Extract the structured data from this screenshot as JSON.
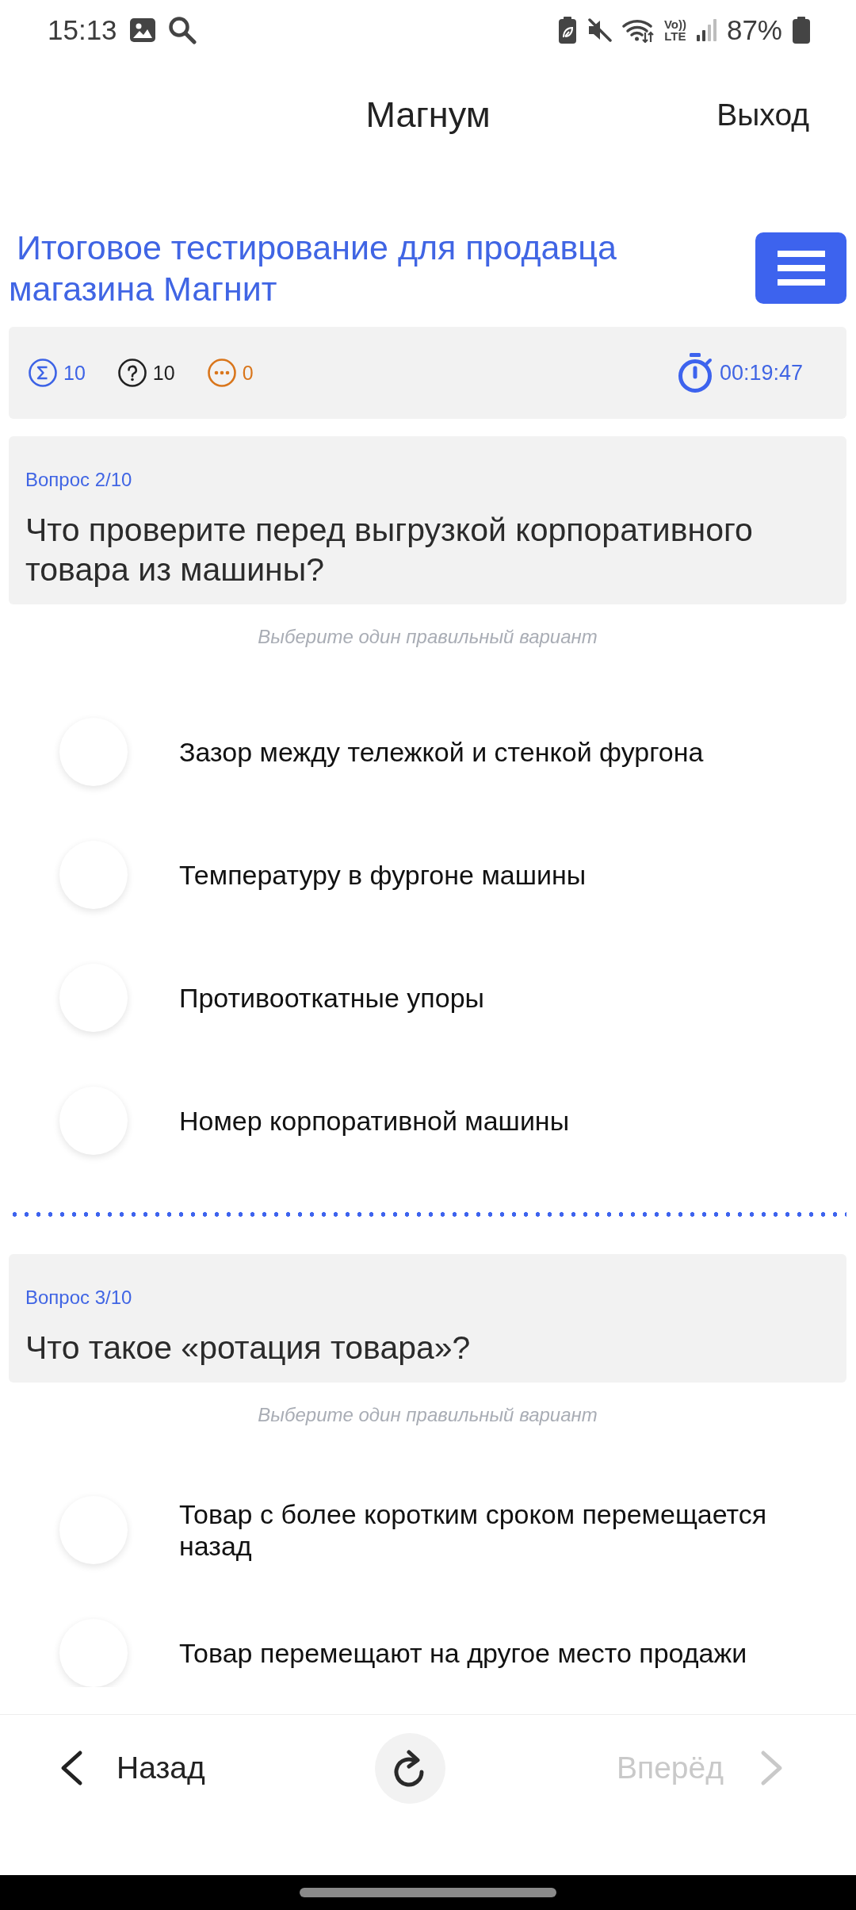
{
  "status_bar": {
    "time": "15:13",
    "volte_top": "Vo))",
    "volte_bottom": "LTE",
    "battery": "87%"
  },
  "header": {
    "title": "Магнум",
    "exit": "Выход"
  },
  "test": {
    "title": "Итоговое тестирование для продавца магазина Магнит"
  },
  "stats": {
    "counters": [
      {
        "kind": "total",
        "value": "10",
        "color": "#3d63e6"
      },
      {
        "kind": "questions",
        "value": "10",
        "color": "#222222"
      },
      {
        "kind": "skipped",
        "value": "0",
        "color": "#d9761c"
      }
    ],
    "timer": "00:19:47"
  },
  "questions": [
    {
      "number": "Вопрос 2/10",
      "text": "Что проверите перед выгрузкой корпоративного товара из машины?",
      "hint": "Выберите один правильный вариант",
      "options": [
        {
          "label": "Зазор между тележкой и стенкой фургона",
          "selected": false
        },
        {
          "label": "Температуру в фургоне машины",
          "selected": false
        },
        {
          "label": "Противооткатные упоры",
          "selected": false
        },
        {
          "label": "Номер корпоративной машины",
          "selected": false
        }
      ]
    },
    {
      "number": "Вопрос 3/10",
      "text": "Что такое «ротация товара»?",
      "hint": "Выберите один правильный вариант",
      "options": [
        {
          "label": "Товар с более коротким сроком перемещается назад",
          "selected": false
        },
        {
          "label": "Товар перемещают на другое место продажи",
          "selected": false
        }
      ]
    }
  ],
  "nav": {
    "back": {
      "label": "Назад",
      "disabled": false
    },
    "forward": {
      "label": "Вперёд",
      "disabled": true
    }
  }
}
